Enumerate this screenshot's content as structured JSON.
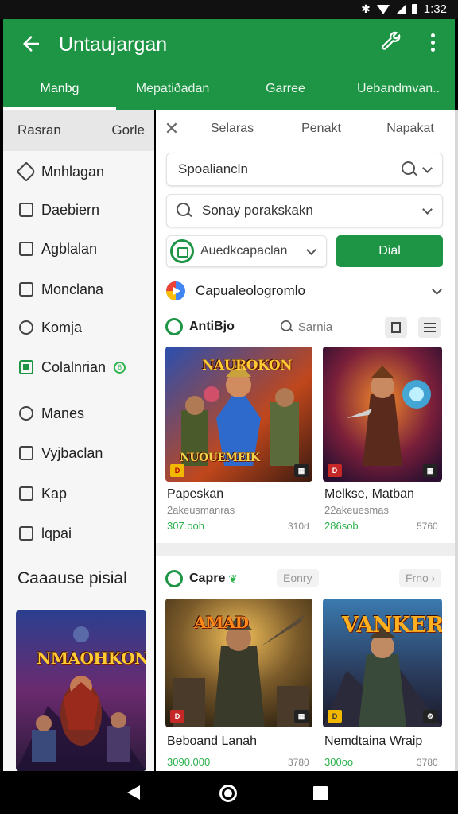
{
  "status_bar": {
    "time": "1:32"
  },
  "app_bar": {
    "title": "Untaujargan",
    "tabs": [
      {
        "label": "Manbg"
      },
      {
        "label": "Mepatiðadan"
      },
      {
        "label": "Garree"
      },
      {
        "label": "Uebandmvan.."
      }
    ]
  },
  "sidebar": {
    "header_left": "Rasran",
    "header_right": "Gorle",
    "items": [
      {
        "label": "Mnhlagan",
        "icon": "tag-icon"
      },
      {
        "label": "Daebiern",
        "icon": "square-icon"
      },
      {
        "label": "Agblalan",
        "icon": "image-icon"
      },
      {
        "label": "Monclana",
        "icon": "square-icon"
      },
      {
        "label": "Komja",
        "icon": "gear-icon"
      },
      {
        "label": "Colalnrian",
        "icon": "apps-icon",
        "badge": "6"
      },
      {
        "label": "Manes",
        "icon": "chat-bubble-icon"
      },
      {
        "label": "Vyjbaclan",
        "icon": "bookmark-icon"
      },
      {
        "label": "Kap",
        "icon": "grid-icon"
      },
      {
        "label": "lqpai",
        "icon": "square-icon"
      }
    ],
    "section_title": "Caaause pisial",
    "poster_title": "NMAOHKON"
  },
  "main": {
    "filter_tabs": [
      "Selaras",
      "Penakt",
      "Napakat"
    ],
    "search_field": "Spoaliancln",
    "sort_field": "Sonay porakskakn",
    "app_select": "Auedkcapaclan",
    "dial_button": "Dial",
    "category_row": "Capualeologromlo",
    "section1": {
      "title": "AntiBjo",
      "search_label": "Sarnia",
      "games": [
        {
          "name": "Papeskan",
          "sub": "2akeusmanras",
          "price": "307.ooh",
          "size": "310d",
          "poster_title": "NAUROKON",
          "poster_sub": "NUOUEMEIK",
          "badge": "D"
        },
        {
          "name": "Melkse, Matban",
          "sub": "22akeuesmas",
          "price": "286sob",
          "size": "5760",
          "badge": "D"
        }
      ]
    },
    "section2": {
      "title": "Capre",
      "pill_left": "Eonry",
      "pill_right": "Frno",
      "games": [
        {
          "name": "Beboand Lanah",
          "price": "3090.000",
          "size": "3780",
          "poster_title": "AMAD",
          "badge": "D"
        },
        {
          "name": "Nemdtaina Wraip",
          "price": "300oo",
          "size": "3780",
          "poster_title": "VANKER",
          "badge": "D"
        }
      ]
    }
  },
  "colors": {
    "primary": "#1e9445",
    "accent_green": "#2bb24c"
  }
}
